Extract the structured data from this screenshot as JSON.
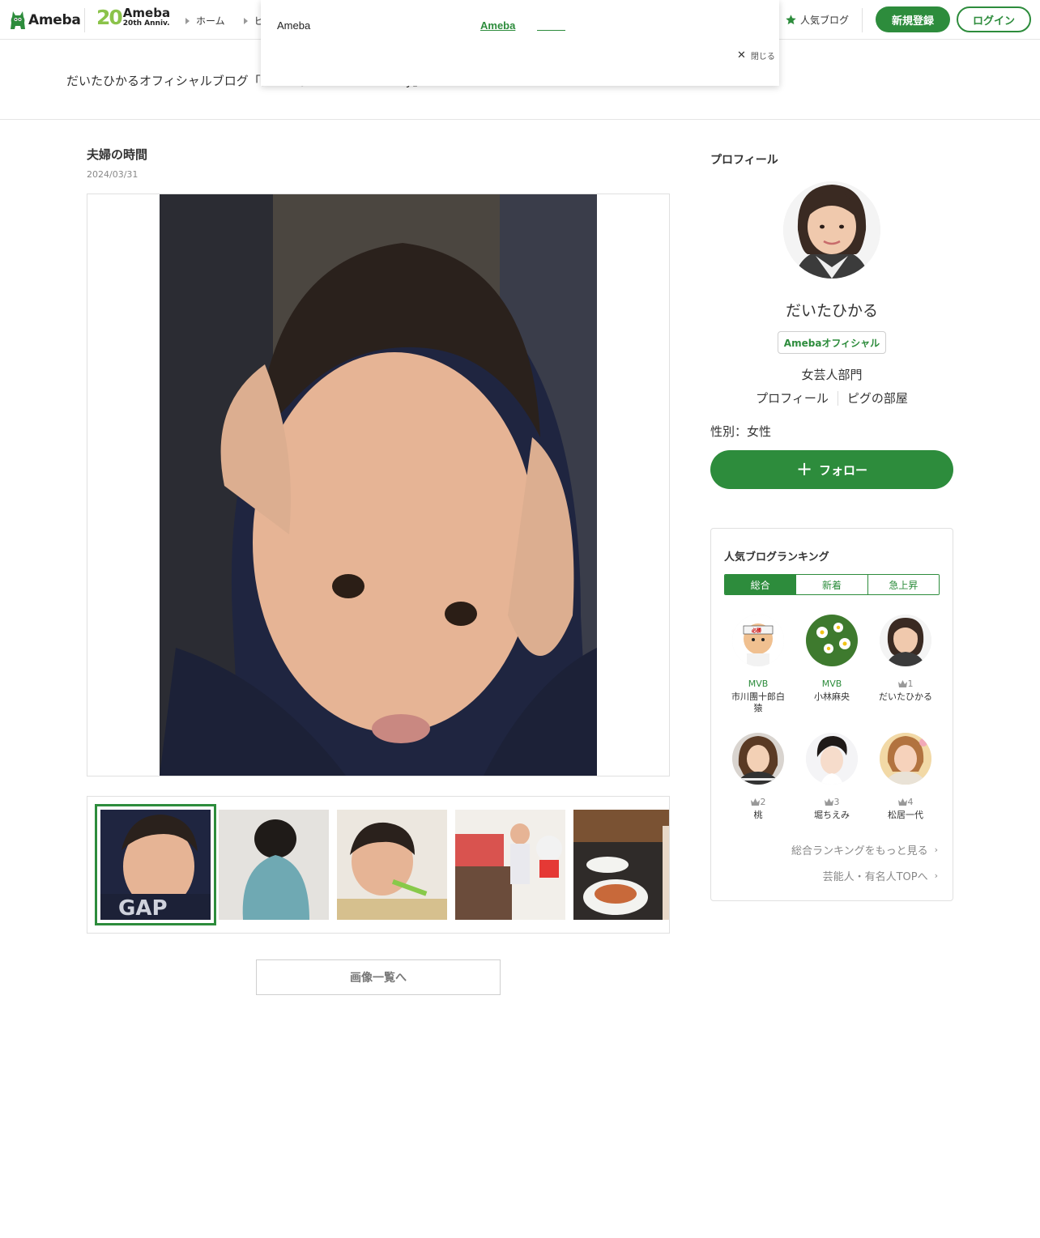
{
  "header": {
    "logo_text": "Ameba",
    "anniv_number": "20",
    "anniv_title": "Ameba",
    "anniv_subtitle": "20th Anniv.",
    "breadcrumb_home": "ホーム",
    "breadcrumb_next": "ピ",
    "popular_blog": "人気ブログ",
    "register": "新規登録",
    "login": "ログイン",
    "brand_color": "#2d8c3c"
  },
  "popup": {
    "brand": "Ameba",
    "link_text": "Ameba",
    "close_label": "閉じる"
  },
  "blog": {
    "title": "だいたひかるオフィシャルブログ「だいたひかるのヒカルdiary」"
  },
  "article": {
    "title": "夫婦の時間",
    "date": "2024/03/31",
    "gallery_button": "画像一覧へ"
  },
  "profile": {
    "heading": "プロフィール",
    "name": "だいたひかる",
    "badge": "Amebaオフィシャル",
    "category": "女芸人部門",
    "link_profile": "プロフィール",
    "link_room": "ピグの部屋",
    "gender": "性別：女性",
    "follow": "フォロー"
  },
  "ranking": {
    "title": "人気ブログランキング",
    "tabs": [
      "総合",
      "新着",
      "急上昇"
    ],
    "items": [
      {
        "rank": "MVB",
        "name": "市川團十郎白猿"
      },
      {
        "rank": "MVB",
        "name": "小林麻央"
      },
      {
        "rank": "1",
        "name": "だいたひかる"
      },
      {
        "rank": "2",
        "name": "桃"
      },
      {
        "rank": "3",
        "name": "堀ちえみ"
      },
      {
        "rank": "4",
        "name": "松居一代"
      }
    ],
    "more_ranking": "総合ランキングをもっと見る",
    "celebrity_top": "芸能人・有名人TOPへ"
  }
}
